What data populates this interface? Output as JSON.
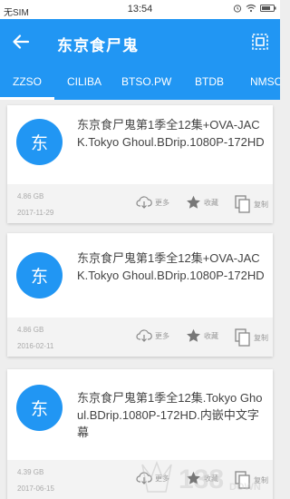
{
  "status": {
    "carrier": "无SIM",
    "time": "13:54"
  },
  "app_bar": {
    "title": "东京食尸鬼",
    "back_icon": "arrow-back-icon",
    "action_icon": "select-all-icon"
  },
  "tabs": [
    {
      "label": "ZZSO",
      "active": true
    },
    {
      "label": "CILIBA",
      "active": false
    },
    {
      "label": "BTSO.PW",
      "active": false
    },
    {
      "label": "BTDB",
      "active": false
    },
    {
      "label": "NMSO",
      "active": false
    }
  ],
  "results": [
    {
      "avatar": "东",
      "title": "东京食尸鬼第1季全12集+OVA-JACK.Tokyo Ghoul.BDrip.1080P-172HD",
      "size": "4.86 GB",
      "date": "2017-11-29",
      "more": "更多",
      "favorite": "收藏",
      "copy": "复制"
    },
    {
      "avatar": "东",
      "title": "东京食尸鬼第1季全12集+OVA-JACK.Tokyo Ghoul.BDrip.1080P-172HD",
      "size": "4.86 GB",
      "date": "2016-02-11",
      "more": "更多",
      "favorite": "收藏",
      "copy": "复制"
    },
    {
      "avatar": "东",
      "title": "东京食尸鬼第1季全12集.Tokyo Ghoul.BDrip.1080P-172HD.内嵌中文字幕",
      "size": "4.39 GB",
      "date": "2017-06-15",
      "more": "更多",
      "favorite": "收藏",
      "copy": "复制"
    }
  ],
  "watermark": {
    "text": "138",
    "subtext": "DOWN"
  },
  "colors": {
    "primary": "#2196f3",
    "background": "#eeeeee",
    "meta_bar": "#f3f3f3"
  }
}
